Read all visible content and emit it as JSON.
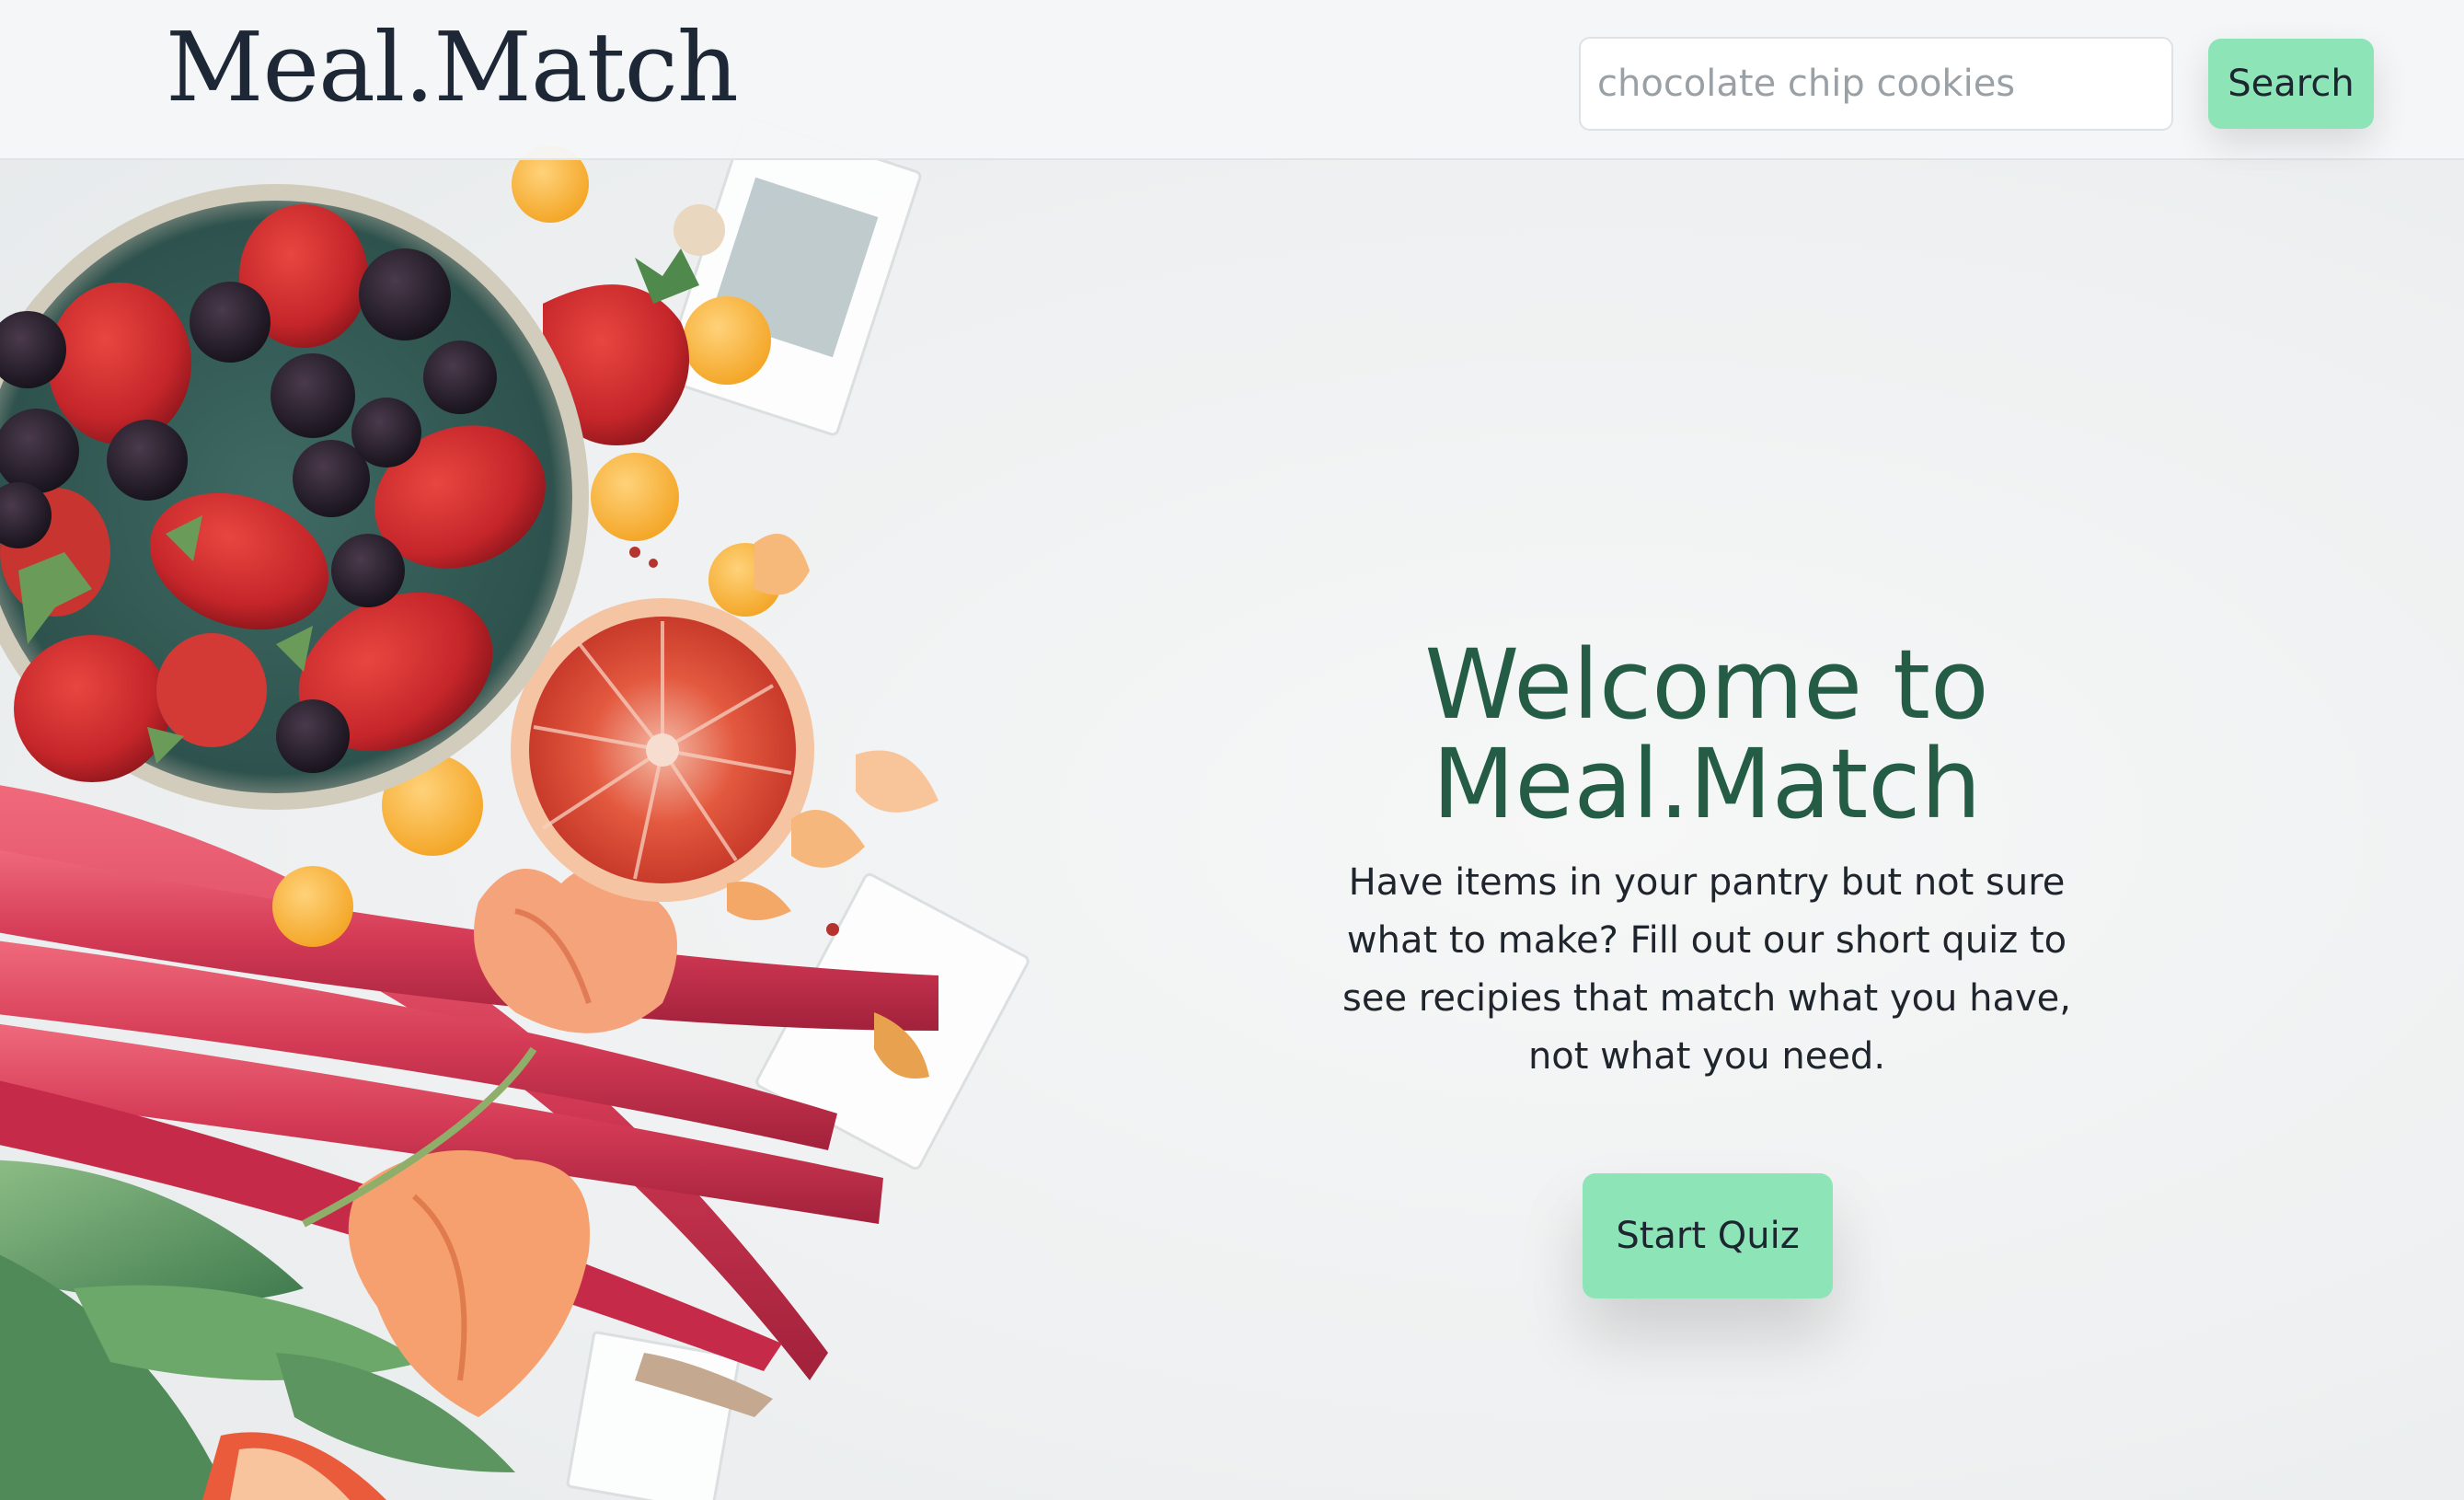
{
  "header": {
    "brand": "Meal.Match",
    "search_placeholder": "chocolate chip cookies",
    "search_value": "",
    "search_button_label": "Search"
  },
  "hero": {
    "title": "Welcome to Meal.Match",
    "description": "Have items in your pantry but not sure what to make? Fill out our short quiz to see recipies that match what you have, not what you need.",
    "cta_label": "Start Quiz"
  },
  "colors": {
    "accent": "#8de4b6",
    "title_green": "#245c45",
    "brand_text": "#1e2736",
    "background": "#eff1f2"
  },
  "icons": {
    "hero_image": "fruit-and-rhubarb-photo"
  }
}
